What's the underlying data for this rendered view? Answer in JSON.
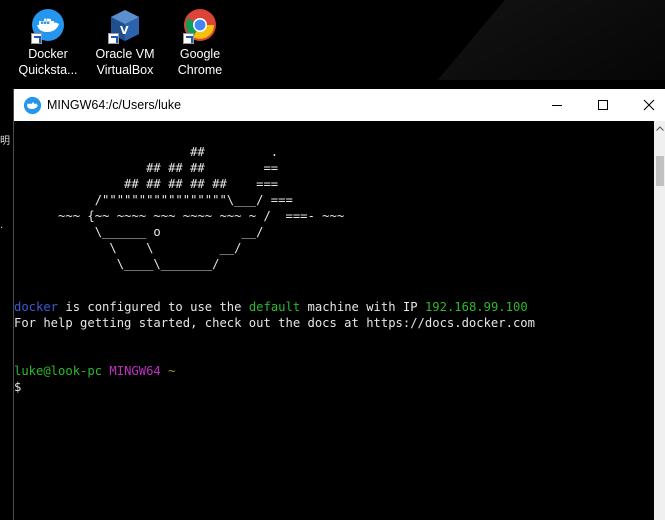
{
  "desktop": {
    "icons": [
      {
        "label_line1": "Docker",
        "label_line2": "Quicksta...",
        "icon": "docker-quickstart-icon"
      },
      {
        "label_line1": "Oracle VM",
        "label_line2": "VirtualBox",
        "icon": "virtualbox-icon"
      },
      {
        "label_line1": "Google",
        "label_line2": "Chrome",
        "icon": "chrome-icon"
      }
    ],
    "edge_glyphs": [
      "明",
      "."
    ]
  },
  "window": {
    "title": "MINGW64:/c/Users/luke",
    "minimize_symbol": "",
    "maximize_symbol": "",
    "close_symbol": "✕"
  },
  "terminal": {
    "ascii_art": [
      "                        ##         .",
      "                  ## ## ##        ==",
      "               ## ## ## ## ##    ===",
      "           /\"\"\"\"\"\"\"\"\"\"\"\"\"\"\"\"\"\\___/ ===",
      "      ~~~ {~~ ~~~~ ~~~ ~~~~ ~~~ ~ /  ===- ~~~",
      "           \\______ o           __/",
      "             \\    \\         __/",
      "              \\____\\_______/"
    ],
    "info_line": {
      "word_docker": "docker",
      "text1": " is configured to use the ",
      "word_default": "default",
      "text2": " machine with IP ",
      "ip": "192.168.99.100"
    },
    "help_line": "For help getting started, check out the docs at https://docs.docker.com",
    "prompt": {
      "user_host": "luke@look-pc",
      "shell": "MINGW64",
      "path": "~",
      "symbol": "$"
    }
  },
  "colors": {
    "docker_blue": "#2496ed",
    "term_blue": "#3b5bd6",
    "term_green": "#2eb82e",
    "term_magenta": "#c030c0",
    "term_yellow": "#b8a000"
  }
}
